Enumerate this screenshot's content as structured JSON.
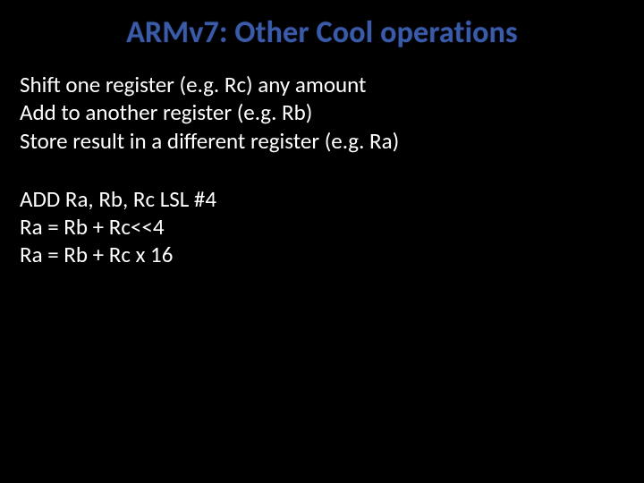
{
  "title": "ARMv7: Other Cool operations",
  "block1": {
    "l1": "Shift one register (e.g. Rc) any amount",
    "l2": "Add to another register (e.g. Rb)",
    "l3": "Store result in a different register (e.g. Ra)"
  },
  "block2": {
    "l1": "ADD Ra, Rb, Rc LSL #4",
    "l2": "Ra = Rb + Rc<<4",
    "l3": "Ra = Rb + Rc x 16"
  }
}
